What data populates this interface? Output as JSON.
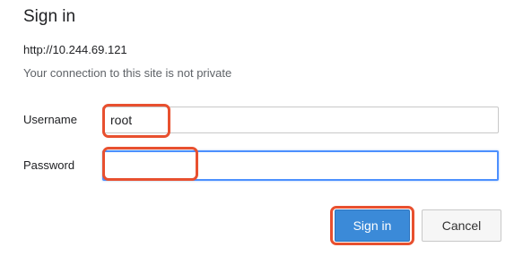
{
  "dialog": {
    "title": "Sign in",
    "origin": "http://10.244.69.121",
    "warning": "Your connection to this site is not private"
  },
  "form": {
    "username_label": "Username",
    "username_value": "root",
    "password_label": "Password",
    "password_value": ""
  },
  "buttons": {
    "signin_label": "Sign in",
    "cancel_label": "Cancel"
  },
  "colors": {
    "highlight": "#e8502f",
    "primary_button": "#3b8ad8",
    "focus_border": "#4d90fe"
  }
}
